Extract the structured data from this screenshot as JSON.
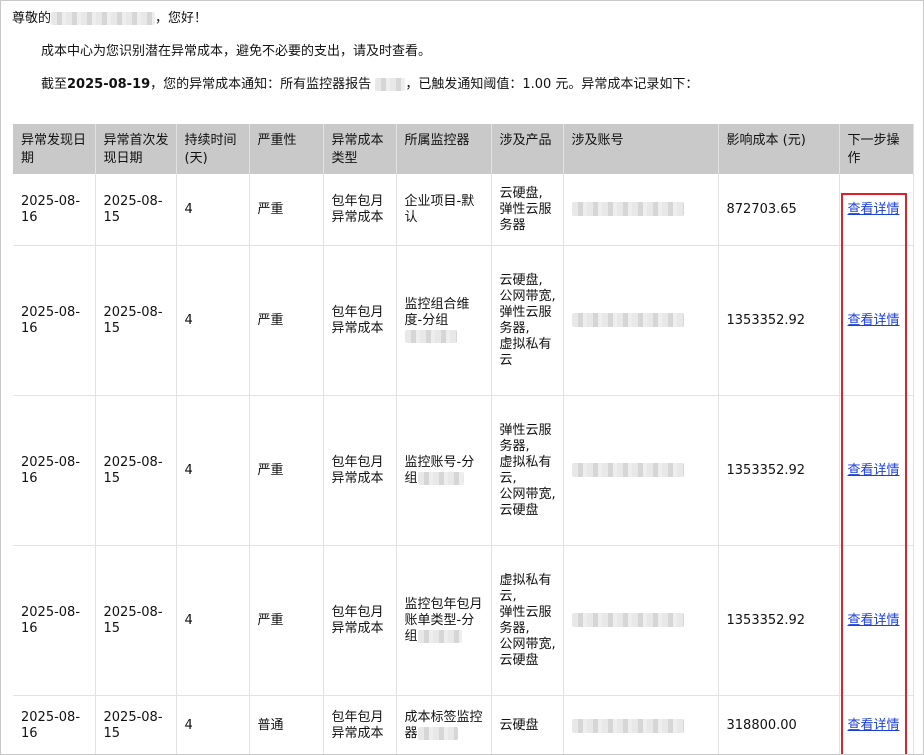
{
  "greeting": {
    "prefix": "尊敬的",
    "suffix": "，您好！"
  },
  "intro": "成本中心为您识别潜在异常成本，避免不必要的支出，请及时查看。",
  "notice": {
    "prefix": "截至",
    "date": "2025-08-19",
    "mid": "，您的异常成本通知：所有监控器报告",
    "suffix": "，已触发通知阈值：1.00 元。异常成本记录如下："
  },
  "table": {
    "headers": [
      "异常发现日期",
      "异常首次发现日期",
      "持续时间(天)",
      "严重性",
      "异常成本类型",
      "所属监控器",
      "涉及产品",
      "涉及账号",
      "影响成本 (元)",
      "下一步操作"
    ],
    "rows": [
      {
        "found": "2025-08-16",
        "first": "2025-08-15",
        "days": "4",
        "severity": "严重",
        "type": "包年包月异常成本",
        "monitor": "企业项目-默认",
        "monitor_redacted": false,
        "products": "云硬盘,\n弹性云服务器",
        "cost": "872703.65",
        "action": "查看详情"
      },
      {
        "found": "2025-08-16",
        "first": "2025-08-15",
        "days": "4",
        "severity": "严重",
        "type": "包年包月异常成本",
        "monitor": "监控组合维度-分组",
        "monitor_redacted": true,
        "products": "云硬盘,\n公网带宽,\n弹性云服务器,\n虚拟私有云",
        "cost": "1353352.92",
        "action": "查看详情"
      },
      {
        "found": "2025-08-16",
        "first": "2025-08-15",
        "days": "4",
        "severity": "严重",
        "type": "包年包月异常成本",
        "monitor": "监控账号-分组",
        "monitor_redacted": true,
        "products": "弹性云服务器,\n虚拟私有云,\n公网带宽,\n云硬盘",
        "cost": "1353352.92",
        "action": "查看详情"
      },
      {
        "found": "2025-08-16",
        "first": "2025-08-15",
        "days": "4",
        "severity": "严重",
        "type": "包年包月异常成本",
        "monitor": "监控包年包月账单类型-分组",
        "monitor_redacted": true,
        "products": "虚拟私有云,\n弹性云服务器,\n公网带宽,\n云硬盘",
        "cost": "1353352.92",
        "action": "查看详情"
      },
      {
        "found": "2025-08-16",
        "first": "2025-08-15",
        "days": "4",
        "severity": "普通",
        "type": "包年包月异常成本",
        "monitor": "成本标签监控器",
        "monitor_redacted": true,
        "products": "云硬盘",
        "cost": "318800.00",
        "action": "查看详情"
      }
    ]
  },
  "colors": {
    "header_bg": "#c9c9c9",
    "link": "#1a3ee0",
    "highlight_box": "#e0202a"
  }
}
